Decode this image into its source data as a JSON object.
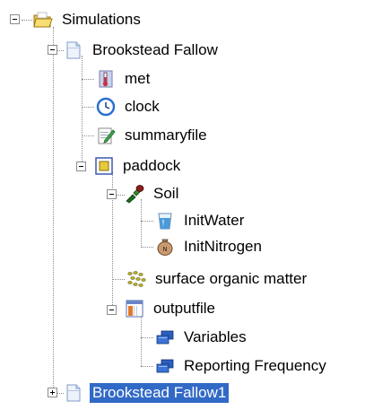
{
  "tree": {
    "root": {
      "label": "Simulations",
      "icon": "folder-icon",
      "expanded": true
    },
    "simulation1": {
      "label": "Brookstead Fallow",
      "icon": "document-icon",
      "expanded": true
    },
    "met": {
      "label": "met",
      "icon": "thermometer-icon"
    },
    "clock": {
      "label": "clock",
      "icon": "clock-icon"
    },
    "summaryfile": {
      "label": "summaryfile",
      "icon": "summary-file-icon"
    },
    "paddock": {
      "label": "paddock",
      "icon": "paddock-icon",
      "expanded": true
    },
    "soil": {
      "label": "Soil",
      "icon": "soil-probe-icon",
      "expanded": true
    },
    "initwater": {
      "label": "InitWater",
      "icon": "water-glass-icon"
    },
    "initnitrogen": {
      "label": "InitNitrogen",
      "icon": "nitrogen-bag-icon"
    },
    "surfaceom": {
      "label": "surface organic matter",
      "icon": "organic-matter-icon"
    },
    "outputfile": {
      "label": "outputfile",
      "icon": "output-file-icon",
      "expanded": true
    },
    "variables": {
      "label": "Variables",
      "icon": "variables-icon"
    },
    "reporting": {
      "label": "Reporting Frequency",
      "icon": "reporting-frequency-icon"
    },
    "simulation2": {
      "label": "Brookstead Fallow1",
      "icon": "document-icon",
      "expanded": false,
      "selected": true
    }
  },
  "colors": {
    "selection": "#3169c6",
    "tree_lines": "#8c8c8c"
  }
}
